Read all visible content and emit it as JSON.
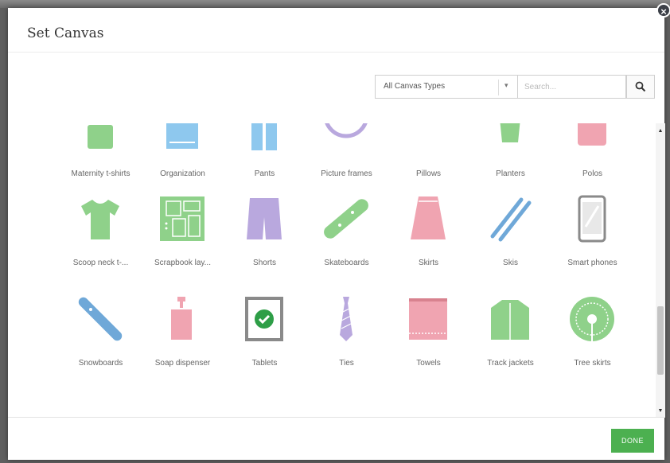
{
  "dialog": {
    "title": "Set Canvas",
    "close_symbol": "×"
  },
  "filter": {
    "selected_type": "All Canvas Types",
    "dropdown_arrow": "▾",
    "search_placeholder": "Search..."
  },
  "grid": {
    "rows": [
      [
        {
          "label": "Maternity t-shirts",
          "icon": "maternity-tshirt-icon",
          "color": "#8fd18a"
        },
        {
          "label": "Organization",
          "icon": "organization-icon",
          "color": "#8ec8ee"
        },
        {
          "label": "Pants",
          "icon": "pants-icon",
          "color": "#8ec8ee"
        },
        {
          "label": "Picture frames",
          "icon": "picture-frame-icon",
          "color": "#b9a8de"
        },
        {
          "label": "Pillows",
          "icon": "pillow-icon",
          "color": "#8fd18a"
        },
        {
          "label": "Planters",
          "icon": "planter-icon",
          "color": "#8fd18a"
        },
        {
          "label": "Polos",
          "icon": "polo-icon",
          "color": "#f0a4b1"
        }
      ],
      [
        {
          "label": "Scoop neck t-...",
          "icon": "scoop-neck-tshirt-icon",
          "color": "#8fd18a"
        },
        {
          "label": "Scrapbook lay...",
          "icon": "scrapbook-layout-icon",
          "color": "#8fd18a"
        },
        {
          "label": "Shorts",
          "icon": "shorts-icon",
          "color": "#b9a8de"
        },
        {
          "label": "Skateboards",
          "icon": "skateboard-icon",
          "color": "#8fd18a"
        },
        {
          "label": "Skirts",
          "icon": "skirt-icon",
          "color": "#f0a4b1"
        },
        {
          "label": "Skis",
          "icon": "skis-icon",
          "color": "#6fa8d8"
        },
        {
          "label": "Smart phones",
          "icon": "smartphone-icon",
          "color": "#8a8a8a"
        }
      ],
      [
        {
          "label": "Snowboards",
          "icon": "snowboard-icon",
          "color": "#6fa8d8"
        },
        {
          "label": "Soap dispenser",
          "icon": "soap-dispenser-icon",
          "color": "#f0a4b1"
        },
        {
          "label": "Tablets",
          "icon": "tablet-icon",
          "color": "#8a8a8a"
        },
        {
          "label": "Ties",
          "icon": "tie-icon",
          "color": "#b9a8de"
        },
        {
          "label": "Towels",
          "icon": "towel-icon",
          "color": "#f0a4b1"
        },
        {
          "label": "Track jackets",
          "icon": "track-jacket-icon",
          "color": "#8fd18a"
        },
        {
          "label": "Tree skirts",
          "icon": "tree-skirt-icon",
          "color": "#8fd18a"
        }
      ],
      [
        {
          "label": "",
          "icon": "tshirt-icon",
          "color": "#9a9a9a"
        },
        {
          "label": "",
          "icon": "umbrella-icon",
          "color": "#8fd18a"
        },
        {
          "label": "",
          "icon": "vneck-tshirt-icon",
          "color": "#6ec0ee"
        },
        {
          "label": "",
          "icon": "long-sleeve-icon",
          "color": "#b9a8de"
        },
        {
          "label": "",
          "icon": "graphic-tshirt-icon",
          "color": "#8fd18a"
        },
        {
          "label": "",
          "icon": "jacket-icon",
          "color": "#6fa8d8"
        },
        {
          "label": "",
          "icon": "window-icon",
          "color": "#6ec0ee"
        }
      ]
    ]
  },
  "scroll": {
    "up_arrow": "▲",
    "down_arrow": "▼"
  },
  "footer": {
    "done_label": "DONE",
    "done_color": "#4cb050"
  }
}
